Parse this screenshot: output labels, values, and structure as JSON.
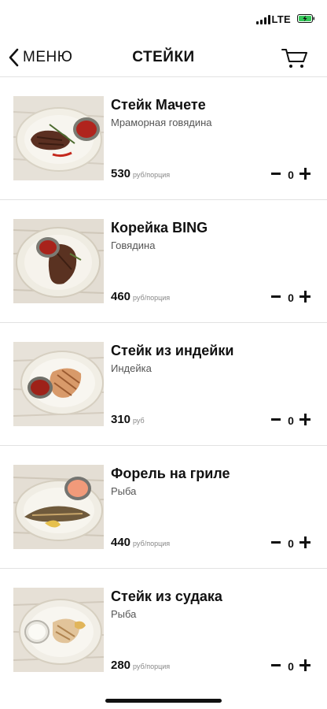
{
  "status_bar": {
    "network": "LTE",
    "signal_bars": 4,
    "battery_charging": true,
    "battery_color": "#35c759"
  },
  "nav": {
    "back_label": "МЕНЮ",
    "title": "СТЕЙКИ",
    "cart_icon": "cart-icon",
    "back_icon": "chevron-left-icon"
  },
  "items": [
    {
      "name": "Стейк Мачете",
      "subtitle": "Мраморная говядина",
      "price": "530",
      "unit": "руб/порция",
      "qty": "0",
      "dish": "steak"
    },
    {
      "name": "Корейка BING",
      "subtitle": "Говядина",
      "price": "460",
      "unit": "руб/порция",
      "qty": "0",
      "dish": "pork"
    },
    {
      "name": "Стейк из индейки",
      "subtitle": "Индейка",
      "price": "310",
      "unit": "руб",
      "qty": "0",
      "dish": "turkey"
    },
    {
      "name": "Форель на гриле",
      "subtitle": "Рыба",
      "price": "440",
      "unit": "руб/порция",
      "qty": "0",
      "dish": "trout"
    },
    {
      "name": "Стейк из судака",
      "subtitle": "Рыба",
      "price": "280",
      "unit": "руб/порция",
      "qty": "0",
      "dish": "zander"
    }
  ]
}
